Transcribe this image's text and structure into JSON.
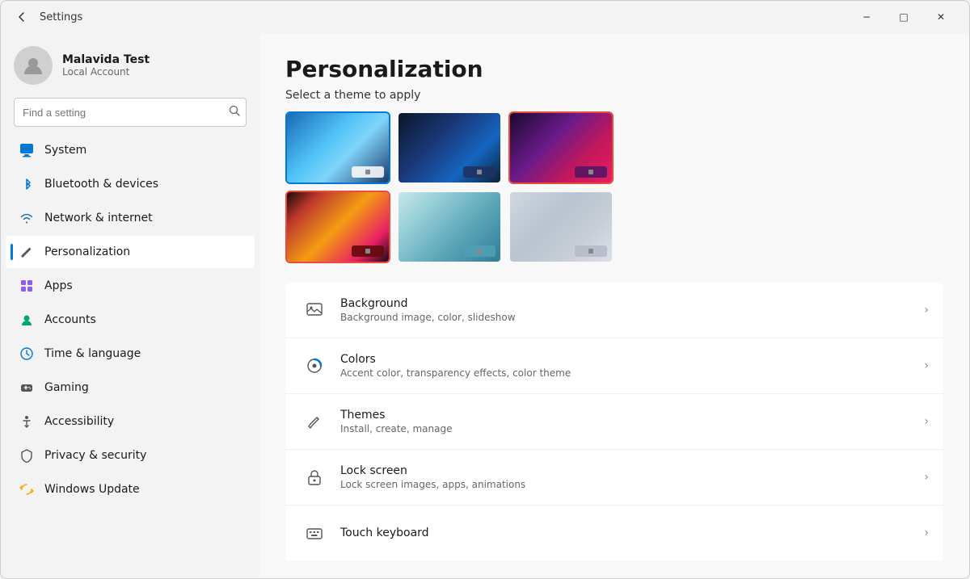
{
  "window": {
    "title": "Settings",
    "back_label": "←",
    "controls": {
      "minimize": "−",
      "maximize": "□",
      "close": "✕"
    }
  },
  "sidebar": {
    "user": {
      "name": "Malavida Test",
      "account_type": "Local Account"
    },
    "search": {
      "placeholder": "Find a setting"
    },
    "nav_items": [
      {
        "id": "system",
        "label": "System",
        "icon": "system"
      },
      {
        "id": "bluetooth",
        "label": "Bluetooth & devices",
        "icon": "bluetooth"
      },
      {
        "id": "network",
        "label": "Network & internet",
        "icon": "network"
      },
      {
        "id": "personalization",
        "label": "Personalization",
        "icon": "personalization",
        "active": true
      },
      {
        "id": "apps",
        "label": "Apps",
        "icon": "apps"
      },
      {
        "id": "accounts",
        "label": "Accounts",
        "icon": "accounts"
      },
      {
        "id": "time",
        "label": "Time & language",
        "icon": "time"
      },
      {
        "id": "gaming",
        "label": "Gaming",
        "icon": "gaming"
      },
      {
        "id": "accessibility",
        "label": "Accessibility",
        "icon": "accessibility"
      },
      {
        "id": "privacy",
        "label": "Privacy & security",
        "icon": "privacy"
      },
      {
        "id": "update",
        "label": "Windows Update",
        "icon": "update"
      }
    ]
  },
  "main": {
    "page_title": "Personalization",
    "theme_section_label": "Select a theme to apply",
    "settings_items": [
      {
        "id": "background",
        "title": "Background",
        "description": "Background image, color, slideshow",
        "icon": "image"
      },
      {
        "id": "colors",
        "title": "Colors",
        "description": "Accent color, transparency effects, color theme",
        "icon": "colors"
      },
      {
        "id": "themes",
        "title": "Themes",
        "description": "Install, create, manage",
        "icon": "themes"
      },
      {
        "id": "lockscreen",
        "title": "Lock screen",
        "description": "Lock screen images, apps, animations",
        "icon": "lock"
      },
      {
        "id": "touchkeyboard",
        "title": "Touch keyboard",
        "description": "",
        "icon": "keyboard"
      }
    ]
  }
}
